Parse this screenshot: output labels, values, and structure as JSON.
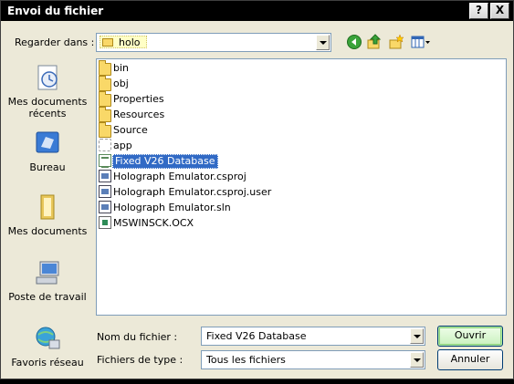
{
  "window": {
    "title": "Envoi du fichier",
    "help_label": "?",
    "close_label": "X"
  },
  "lookin": {
    "label": "Regarder dans :",
    "value": "holo"
  },
  "toolbar": {
    "icons": [
      "back-arrow-icon",
      "up-folder-icon",
      "new-folder-icon",
      "view-menu-icon"
    ]
  },
  "places": [
    {
      "label": "Mes documents récents",
      "icon": "recent-documents-icon"
    },
    {
      "label": "Bureau",
      "icon": "desktop-icon"
    },
    {
      "label": "Mes documents",
      "icon": "my-documents-icon"
    },
    {
      "label": "Poste de travail",
      "icon": "my-computer-icon"
    },
    {
      "label": "Favoris réseau",
      "icon": "network-places-icon"
    }
  ],
  "files": [
    {
      "name": "bin",
      "type": "folder"
    },
    {
      "name": "obj",
      "type": "folder"
    },
    {
      "name": "Properties",
      "type": "folder"
    },
    {
      "name": "Resources",
      "type": "folder"
    },
    {
      "name": "Source",
      "type": "folder"
    },
    {
      "name": "app",
      "type": "app"
    },
    {
      "name": "Fixed V26 Database",
      "type": "database",
      "selected": true
    },
    {
      "name": "Holograph Emulator.csproj",
      "type": "project"
    },
    {
      "name": "Holograph Emulator.csproj.user",
      "type": "project"
    },
    {
      "name": "Holograph Emulator.sln",
      "type": "project"
    },
    {
      "name": "MSWINSCK.OCX",
      "type": "ocx"
    }
  ],
  "filename": {
    "label": "Nom du fichier :",
    "value": "Fixed V26 Database"
  },
  "filetype": {
    "label": "Fichiers de type :",
    "value": "Tous les fichiers"
  },
  "buttons": {
    "open": "Ouvrir",
    "cancel": "Annuler"
  },
  "colors": {
    "selection": "#316ac5",
    "default_button": "#c9f1bd",
    "dialog_bg": "#ece9d8"
  }
}
